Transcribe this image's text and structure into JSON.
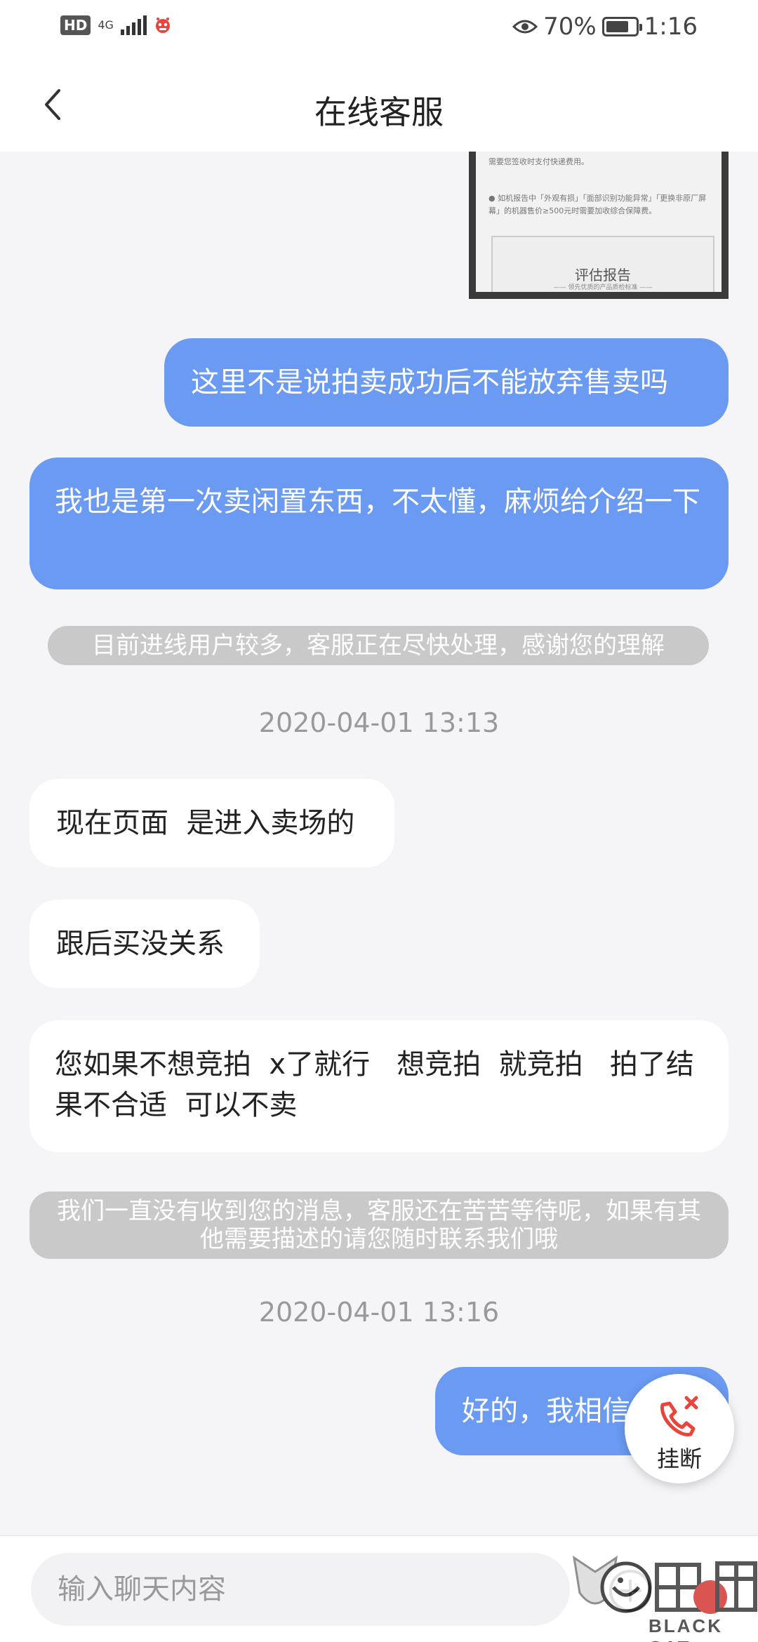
{
  "status_bar": {
    "hd": "HD",
    "network": "4G",
    "battery_percent": "70%",
    "battery_level": 0.7,
    "time": "1:16",
    "icons": [
      "hd-icon",
      "signal-icon",
      "app-notification-icon",
      "eye-comfort-icon",
      "battery-icon"
    ]
  },
  "header": {
    "title": "在线客服",
    "back_icon": "chevron-left-icon"
  },
  "chat": {
    "image_preview": {
      "line1": "需要您签收时支付快递费用。",
      "line2": "● 如机报告中「外观有损」「面部识别功能异常」「更换非原厂屏幕」的机器售价≥500元时需要加收综合保障费。",
      "card_title": "评估报告",
      "card_subtitle": "—— 领先优质的产品质检标准 ——"
    },
    "messages": [
      {
        "side": "right",
        "text": "这里不是说拍卖成功后不能放弃售卖吗"
      },
      {
        "side": "right",
        "text": "我也是第一次卖闲置东西，不太懂，麻烦给介绍一下"
      },
      {
        "type": "notice",
        "text": "目前进线用户较多，客服正在尽快处理，感谢您的理解"
      },
      {
        "type": "time",
        "text": "2020-04-01 13:13"
      },
      {
        "side": "left",
        "text": "现在页面  是进入卖场的"
      },
      {
        "side": "left",
        "text": "跟后买没关系"
      },
      {
        "side": "left",
        "text": "您如果不想竞拍  x了就行   想竞拍  就竞拍   拍了结果不合适  可以不卖"
      },
      {
        "type": "notice",
        "text": "我们一直没有收到您的消息，客服还在苦苦等待呢，如果有其他需要描述的请您随时联系我们哦"
      },
      {
        "type": "time",
        "text": "2020-04-01 13:16"
      },
      {
        "side": "right",
        "text": "好的，我相信"
      }
    ]
  },
  "hangup": {
    "label": "挂断",
    "icon": "phone-hangup-icon",
    "accent": "#e8453c"
  },
  "input_bar": {
    "placeholder": "输入聊天内容",
    "plus_icon": "plus-icon"
  },
  "watermark": {
    "text": "BLACK CAT",
    "logo_text": "黑猫"
  },
  "colors": {
    "bubble_right": "#6a9af2",
    "bubble_left": "#ffffff",
    "notice": "#c9c9c9",
    "background": "#f5f5f7"
  }
}
